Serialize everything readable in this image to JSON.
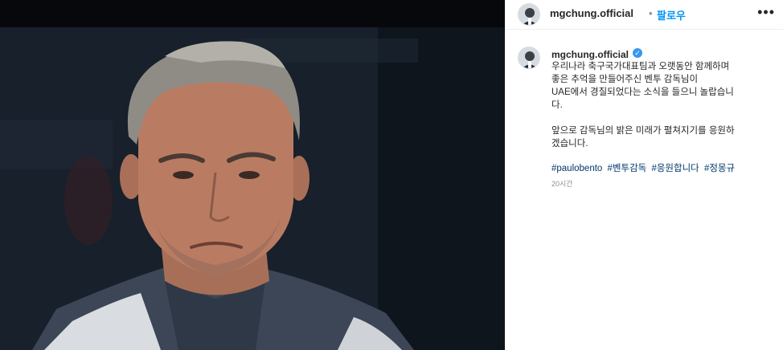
{
  "post": {
    "username": "mgchung.official",
    "separator": "•",
    "follow_label": "팔로우",
    "more_icon": "more-options-icon",
    "caption_user": "mgchung.official",
    "verified_icon": "verified-badge-icon",
    "caption_text": "우리나라 축구국가대표팀과 오랫동안 함께하며\n좋은 추억을 만들어주신 벤투 감독님이\nUAE에서 경질되었다는 소식을 들으니 놀랍습니\n다.\n\n앞으로 감독님의 밝은 미래가 펼쳐지기를 응원하\n겠습니다.",
    "hashtags": [
      "#paulobento",
      "#벤투감독",
      "#응원합니다",
      "#정몽규"
    ],
    "timestamp": "20시간"
  },
  "colors": {
    "follow": "#0095f6",
    "hashtag": "#00376b",
    "verified": "#3897f0",
    "muted": "#8e8e8e"
  }
}
